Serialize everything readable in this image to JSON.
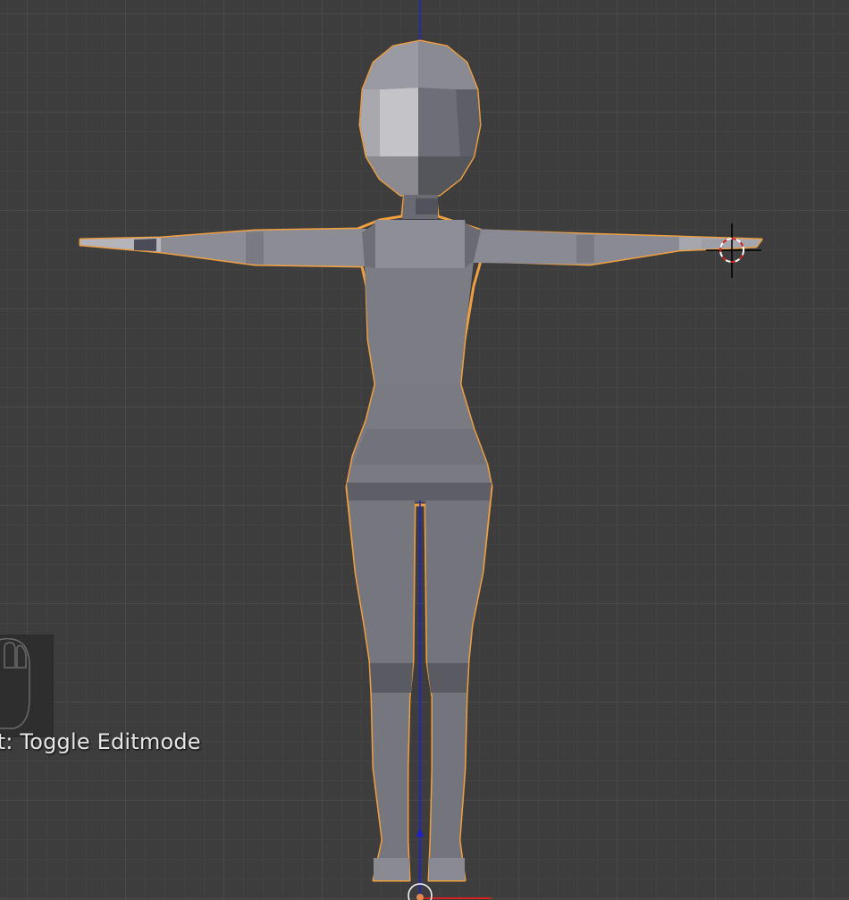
{
  "viewport": {
    "last_operator": "st: Toggle Editmode",
    "grid_visible": true,
    "colors": {
      "background": "#3d3d3d",
      "grid_major": "#4a4a4a",
      "grid_minor": "#434343",
      "selection_outline": "#f0a040",
      "z_axis": "#2020d0",
      "x_axis": "#d02020",
      "mesh_base": "#77777f"
    },
    "object": {
      "name_icon": "mesh-object-icon",
      "selected": true
    },
    "cursor_icon": "3d-cursor-icon",
    "mouse_icon": "mouse-icon"
  }
}
